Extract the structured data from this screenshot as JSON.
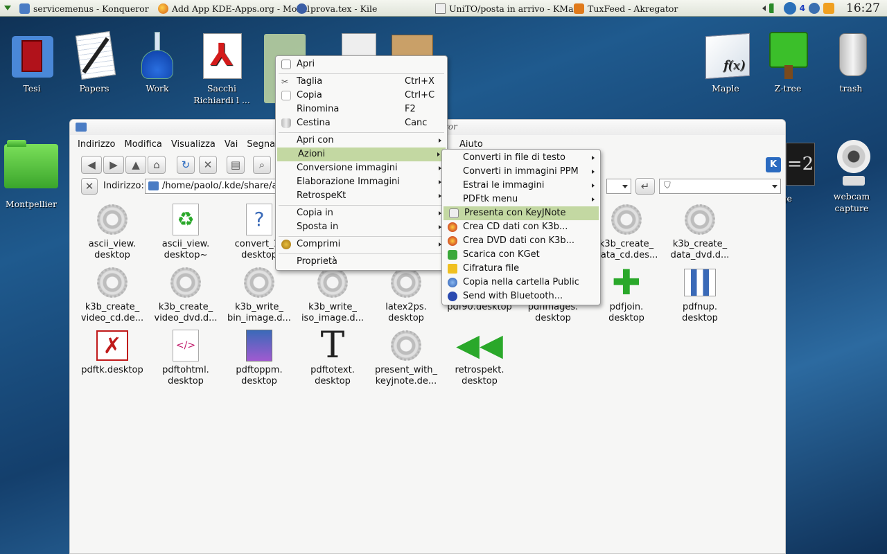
{
  "taskbar": {
    "tasks": [
      {
        "label": "servicemenus - Konqueror",
        "icon": "folder-icon"
      },
      {
        "label": "Add App KDE-Apps.org - Mozill",
        "icon": "firefox-icon"
      },
      {
        "label": "prova.tex - Kile",
        "icon": "kile-icon"
      },
      {
        "label": "UniTO/posta in arrivo - KMail",
        "icon": "kmail-icon"
      },
      {
        "label": "TuxFeed - Akregator",
        "icon": "akregator-icon"
      }
    ],
    "tray_badge": "4",
    "clock": "16:27"
  },
  "desktop": {
    "icons": [
      {
        "label": "Tesi",
        "icon": "pdf-folder-icon"
      },
      {
        "label": "Papers",
        "icon": "notepad-icon"
      },
      {
        "label": "Work",
        "icon": "flask-icon"
      },
      {
        "label": "Sacchi Richiardi l ...",
        "icon": "pdf-icon"
      },
      {
        "label": "Maple",
        "icon": "maple-icon"
      },
      {
        "label": "Z-tree",
        "icon": "tree-icon"
      },
      {
        "label": "trash",
        "icon": "trash-icon"
      },
      {
        "label": "Montpellier",
        "icon": "folder-icon"
      },
      {
        "label": "webcam capture",
        "icon": "webcam-icon"
      },
      {
        "label": "age",
        "icon": "image-icon"
      }
    ]
  },
  "window": {
    "title_fragment": "ror",
    "menubar": [
      "Indirizzo",
      "Modifica",
      "Visualizza",
      "Vai",
      "Segnal",
      "Aiuto"
    ],
    "address_label": "Indirizzo:",
    "address_value": "/home/paolo/.kde/share/a",
    "files": [
      {
        "label": "ascii_view.\ndesktop",
        "icon": "gear-icon"
      },
      {
        "label": "ascii_view.\ndesktop~",
        "icon": "recycle-icon"
      },
      {
        "label": "convert_1_\ndesktop",
        "icon": "unknown-file-icon"
      },
      {
        "label": "k3b_create_\ndata_cd.des...",
        "icon": "gear-icon"
      },
      {
        "label": "k3b_create_\ndata_dvd.d...",
        "icon": "gear-icon"
      },
      {
        "label": "k3b_create_\nvideo_cd.de...",
        "icon": "gear-icon"
      },
      {
        "label": "k3b_create_\nvideo_dvd.d...",
        "icon": "gear-icon"
      },
      {
        "label": "k3b_write_\nbin_image.d...",
        "icon": "gear-icon"
      },
      {
        "label": "k3b_write_\niso_image.d...",
        "icon": "gear-icon"
      },
      {
        "label": "latex2ps.\ndesktop",
        "icon": "gear-icon"
      },
      {
        "label": "pdf90.desktop",
        "icon": "gear-icon"
      },
      {
        "label": "pdfimages.\ndesktop",
        "icon": "gear-icon"
      },
      {
        "label": "pdfjoin.\ndesktop",
        "icon": "plus-icon"
      },
      {
        "label": "pdfnup.\ndesktop",
        "icon": "layout-icon"
      },
      {
        "label": "pdftk.desktop",
        "icon": "pdftk-icon"
      },
      {
        "label": "pdftohtml.\ndesktop",
        "icon": "html-icon"
      },
      {
        "label": "pdftoppm.\ndesktop",
        "icon": "image-file-icon"
      },
      {
        "label": "pdftotext.\ndesktop",
        "icon": "text-t-icon"
      },
      {
        "label": "present_with_\nkeyjnote.de...",
        "icon": "gear-icon"
      },
      {
        "label": "retrospekt.\ndesktop",
        "icon": "rewind-icon"
      }
    ]
  },
  "context_menu": [
    {
      "label": "Apri",
      "shortcut": ""
    },
    {
      "label": "Taglia",
      "shortcut": "Ctrl+X"
    },
    {
      "label": "Copia",
      "shortcut": "Ctrl+C"
    },
    {
      "label": "Rinomina",
      "shortcut": "F2"
    },
    {
      "label": "Cestina",
      "shortcut": "Canc"
    },
    {
      "label": "Apri con",
      "shortcut": ""
    },
    {
      "label": "Azioni",
      "shortcut": ""
    },
    {
      "label": "Conversione immagini",
      "shortcut": ""
    },
    {
      "label": "Elaborazione Immagini",
      "shortcut": ""
    },
    {
      "label": "RetrospeKt",
      "shortcut": ""
    },
    {
      "label": "Copia in",
      "shortcut": ""
    },
    {
      "label": "Sposta in",
      "shortcut": ""
    },
    {
      "label": "Comprimi",
      "shortcut": ""
    },
    {
      "label": "Proprietà",
      "shortcut": ""
    }
  ],
  "submenu": [
    {
      "label": "Converti in file di testo"
    },
    {
      "label": "Converti in immagini PPM"
    },
    {
      "label": "Estrai le immagini"
    },
    {
      "label": "PDFtk menu"
    },
    {
      "label": "Presenta con KeyJNote"
    },
    {
      "label": "Crea CD dati con K3b..."
    },
    {
      "label": "Crea DVD dati con K3b..."
    },
    {
      "label": "Scarica con KGet"
    },
    {
      "label": "Cifratura file"
    },
    {
      "label": "Copia nella cartella Public"
    },
    {
      "label": "Send with Bluetooth..."
    }
  ],
  "colors": {
    "highlight": "#c3d8a2",
    "accent": "#3d6bb3"
  }
}
